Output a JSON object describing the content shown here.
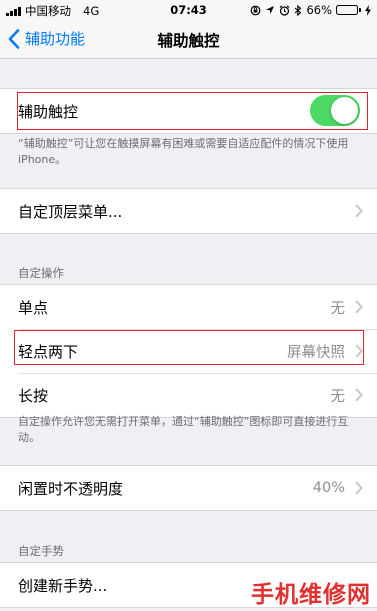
{
  "status_bar": {
    "carrier": "中国移动",
    "network": "4G",
    "time": "07:43",
    "battery_percent": "66%",
    "battery_level": 0.66,
    "icons": [
      "orientation-lock-icon",
      "location-icon",
      "alarm-icon",
      "bluetooth-icon",
      "battery-icon",
      "charging-icon"
    ]
  },
  "nav": {
    "back_label": "辅助功能",
    "title": "辅助触控"
  },
  "toggle_section": {
    "label": "辅助触控",
    "enabled": true,
    "footnote": "“辅助触控”可让您在触摸屏幕有困难或需要自适应配件的情况下使用 iPhone。"
  },
  "menu_section": {
    "label": "自定顶层菜单..."
  },
  "custom_actions": {
    "header": "自定操作",
    "items": [
      {
        "label": "单点",
        "value": "无"
      },
      {
        "label": "轻点两下",
        "value": "屏幕快照"
      },
      {
        "label": "长按",
        "value": "无"
      }
    ],
    "footnote": "自定操作允许您无需打开菜单，通过“辅助触控”图标即可直接进行互动。"
  },
  "idle_opacity": {
    "label": "闲置时不透明度",
    "value": "40%"
  },
  "custom_gestures": {
    "header": "自定手势",
    "create_label": "创建新手势..."
  },
  "watermark": "手机维修网",
  "colors": {
    "accent": "#007aff",
    "toggle_on": "#4cd964",
    "highlight": "#e0242f",
    "watermark": "#e3302f"
  }
}
